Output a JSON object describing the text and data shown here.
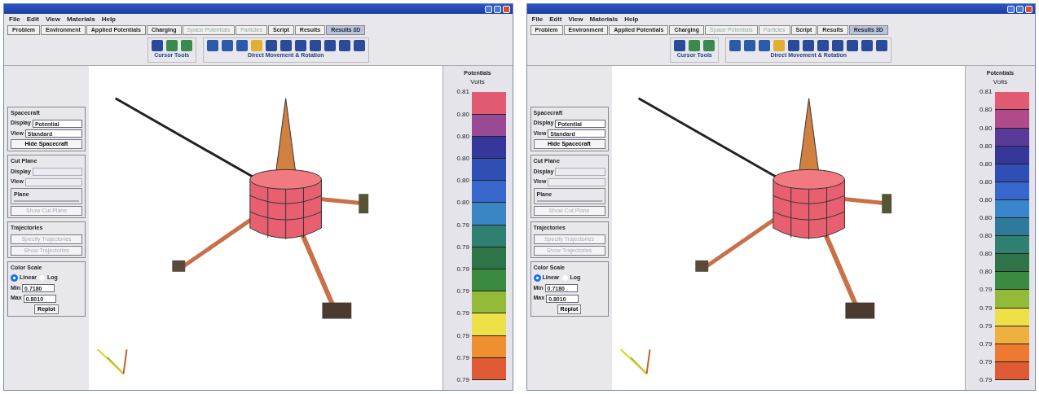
{
  "screens": [
    {
      "menu": [
        "File",
        "Edit",
        "View",
        "Materials",
        "Help"
      ],
      "tabs": [
        {
          "label": "Problem",
          "selected": false,
          "disabled": false
        },
        {
          "label": "Environment",
          "selected": false,
          "disabled": false
        },
        {
          "label": "Applied Potentials",
          "selected": false,
          "disabled": false
        },
        {
          "label": "Charging",
          "selected": false,
          "disabled": false
        },
        {
          "label": "Space Potentials",
          "selected": false,
          "disabled": true
        },
        {
          "label": "Particles",
          "selected": false,
          "disabled": true
        },
        {
          "label": "Script",
          "selected": false,
          "disabled": false
        },
        {
          "label": "Results",
          "selected": false,
          "disabled": false
        },
        {
          "label": "Results 3D",
          "selected": true,
          "disabled": false
        }
      ],
      "toolbar": [
        {
          "label": "Cursor Tools",
          "kind": "cursor"
        },
        {
          "label": "Direct Movement & Rotation",
          "kind": "movement"
        }
      ],
      "spacecraft": {
        "title": "Spacecraft",
        "display_label": "Display",
        "display": "Potential",
        "view_label": "View",
        "view": "Standard",
        "button": "Hide Spacecraft"
      },
      "cut_plane": {
        "title": "Cut Plane",
        "display_label": "Display",
        "view_label": "View",
        "plane_title": "Plane",
        "button": "Show Cut Plane",
        "disabled": true
      },
      "trajectories": {
        "title": "Trajectories",
        "buttons": [
          "Specify Trajectories",
          "Show Trajectories"
        ],
        "disabled": true
      },
      "color_scale": {
        "title": "Color Scale",
        "options": [
          {
            "label": "Linear",
            "selected": true
          },
          {
            "label": "Log",
            "selected": false
          }
        ],
        "min_label": "Min",
        "min": "0.7180",
        "max_label": "Max",
        "max": "0.8010",
        "button": "Replot"
      },
      "legend": {
        "title": "Potentials",
        "unit": "Volts",
        "ticks": [
          "0.81",
          "0.80",
          "0.80",
          "0.80",
          "0.80",
          "0.80",
          "0.79",
          "0.79",
          "0.79",
          "0.79",
          "0.79",
          "0.79",
          "0.79",
          "0.79"
        ],
        "bands": [
          {
            "color": "#e05a72"
          },
          {
            "color": "#9a4a94"
          },
          {
            "color": "#35389a"
          },
          {
            "color": "#2f4fb5"
          },
          {
            "color": "#3766cc"
          },
          {
            "color": "#3a86c4"
          },
          {
            "color": "#2f8070"
          },
          {
            "color": "#2e7448"
          },
          {
            "color": "#3a8a40"
          },
          {
            "color": "#94ba3a"
          },
          {
            "color": "#eee048"
          },
          {
            "color": "#ee9030"
          },
          {
            "color": "#e05a34"
          }
        ]
      }
    },
    {
      "menu": [
        "File",
        "Edit",
        "View",
        "Materials",
        "Help"
      ],
      "tabs": [
        {
          "label": "Problem",
          "selected": false,
          "disabled": false
        },
        {
          "label": "Environment",
          "selected": false,
          "disabled": false
        },
        {
          "label": "Applied Potentials",
          "selected": false,
          "disabled": false
        },
        {
          "label": "Charging",
          "selected": false,
          "disabled": false
        },
        {
          "label": "Space Potentials",
          "selected": false,
          "disabled": true
        },
        {
          "label": "Particles",
          "selected": false,
          "disabled": true
        },
        {
          "label": "Script",
          "selected": false,
          "disabled": false
        },
        {
          "label": "Results",
          "selected": false,
          "disabled": false
        },
        {
          "label": "Results 3D",
          "selected": true,
          "disabled": false
        }
      ],
      "toolbar": [
        {
          "label": "Cursor Tools",
          "kind": "cursor"
        },
        {
          "label": "Direct Movement & Rotation",
          "kind": "movement"
        }
      ],
      "spacecraft": {
        "title": "Spacecraft",
        "display_label": "Display",
        "display": "Potential",
        "view_label": "View",
        "view": "Standard",
        "button": "Hide Spacecraft"
      },
      "cut_plane": {
        "title": "Cut Plane",
        "display_label": "Display",
        "view_label": "View",
        "plane_title": "Plane",
        "button": "Show Cut Plane",
        "disabled": true
      },
      "trajectories": {
        "title": "Trajectories",
        "buttons": [
          "Specify Trajectories",
          "Show Trajectories"
        ],
        "disabled": true
      },
      "color_scale": {
        "title": "Color Scale",
        "options": [
          {
            "label": "Linear",
            "selected": true
          },
          {
            "label": "Log",
            "selected": false
          }
        ],
        "min_label": "Min",
        "min": "0.7180",
        "max_label": "Max",
        "max": "0.8010",
        "button": "Replot"
      },
      "legend": {
        "title": "Potentials",
        "unit": "Volts",
        "ticks": [
          "0.81",
          "0.80",
          "0.80",
          "0.80",
          "0.80",
          "0.80",
          "0.80",
          "0.80",
          "0.80",
          "0.80",
          "0.80",
          "0.79",
          "0.79",
          "0.79",
          "0.79",
          "0.79",
          "0.79"
        ],
        "bands": [
          {
            "color": "#e05a72"
          },
          {
            "color": "#b04a88"
          },
          {
            "color": "#5a3a98"
          },
          {
            "color": "#35389a"
          },
          {
            "color": "#2f4fb5"
          },
          {
            "color": "#3766cc"
          },
          {
            "color": "#3a86cc"
          },
          {
            "color": "#2f7a9a"
          },
          {
            "color": "#2f8070"
          },
          {
            "color": "#2e7448"
          },
          {
            "color": "#3a8a40"
          },
          {
            "color": "#94ba3a"
          },
          {
            "color": "#eee048"
          },
          {
            "color": "#f0b040"
          },
          {
            "color": "#ee7a30"
          },
          {
            "color": "#e05a34"
          }
        ]
      }
    }
  ]
}
